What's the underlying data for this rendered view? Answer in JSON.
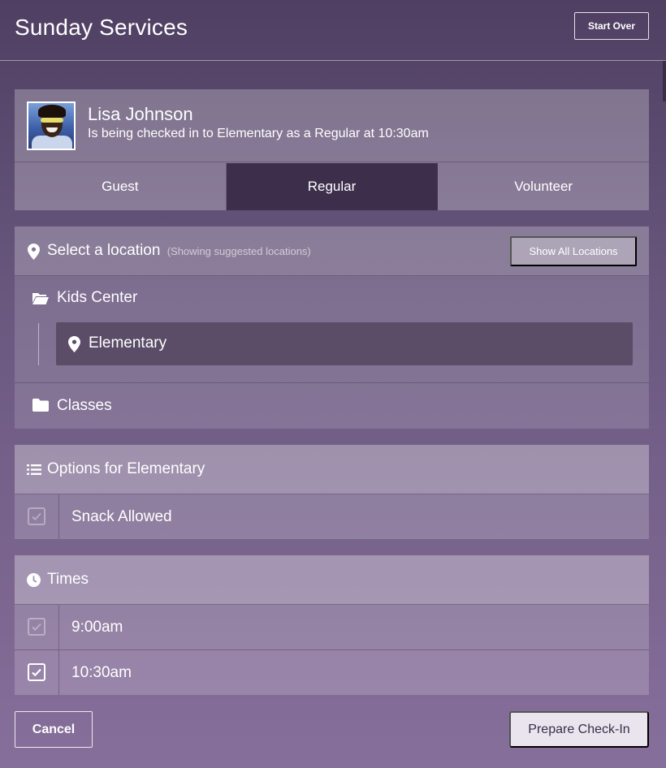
{
  "header": {
    "title": "Sunday Services",
    "start_over_label": "Start Over"
  },
  "person": {
    "name": "Lisa Johnson",
    "status": "Is being checked in to Elementary as a Regular at 10:30am",
    "tabs": [
      {
        "label": "Guest",
        "active": false
      },
      {
        "label": "Regular",
        "active": true
      },
      {
        "label": "Volunteer",
        "active": false
      }
    ]
  },
  "location": {
    "title": "Select a location",
    "hint": "(Showing suggested locations)",
    "show_all_label": "Show All Locations",
    "groups": [
      {
        "label": "Kids Center",
        "icon": "folder-open-icon",
        "items": [
          {
            "label": "Elementary",
            "selected": true
          }
        ]
      },
      {
        "label": "Classes",
        "icon": "folder-icon"
      }
    ]
  },
  "options": {
    "title": "Options for Elementary",
    "items": [
      {
        "label": "Snack Allowed",
        "checked": false
      }
    ]
  },
  "times": {
    "title": "Times",
    "items": [
      {
        "label": "9:00am",
        "checked": false
      },
      {
        "label": "10:30am",
        "checked": true
      }
    ]
  },
  "actions": {
    "cancel_label": "Cancel",
    "prepare_label": "Prepare Check-In"
  },
  "colors": {
    "active_tab": "#3d2f4b",
    "selected_location": "#5b4d68",
    "primary_button": "#e9e4ee"
  }
}
